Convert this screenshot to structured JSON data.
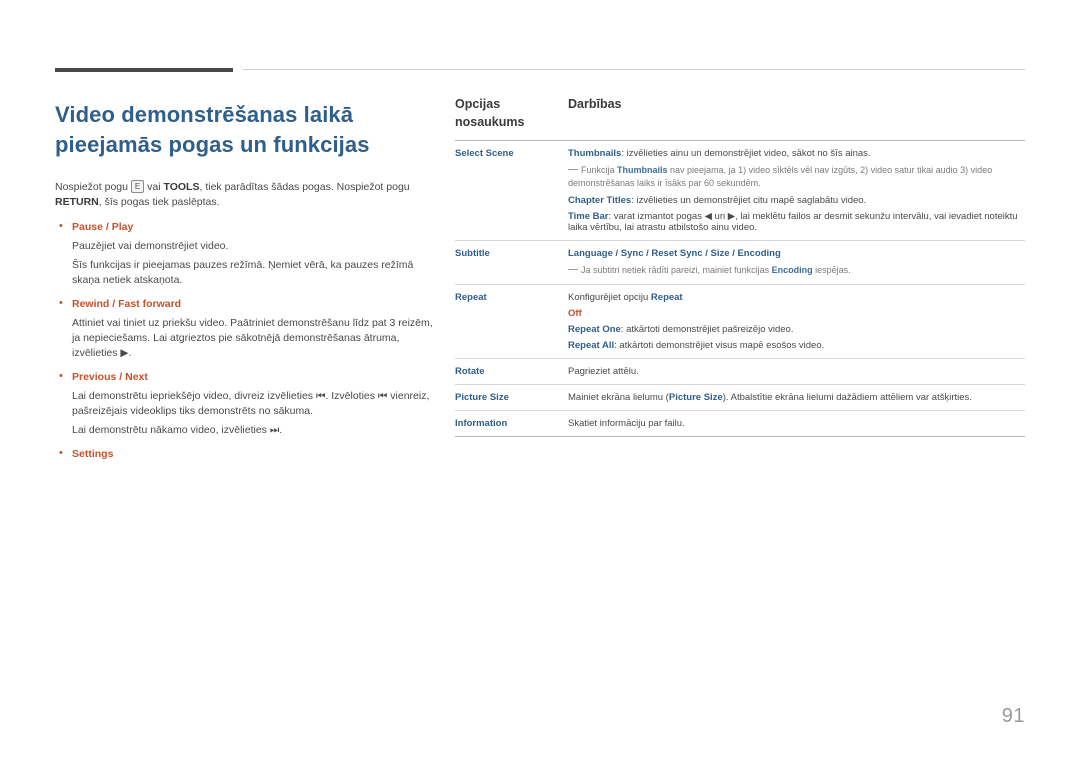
{
  "title": "Video demonstrēšanas laikā pieejamās pogas un funkcijas",
  "page_number": "91",
  "left": {
    "intro_parts": {
      "p1": "Nospiežot pogu ",
      "icon1": "E",
      "p2": " vai ",
      "tools": "TOOLS",
      "p3": ", tiek parādītas šādas pogas. Nospiežot pogu ",
      "return": "RETURN",
      "p4": ", šīs pogas tiek paslēptas."
    },
    "items": [
      {
        "head": "Pause / Play",
        "lines": [
          "Pauzējiet vai demonstrējiet video.",
          "Šīs funkcijas ir pieejamas pauzes režīmā. Ņemiet vērā, ka pauzes režīmā skaņa netiek atskaņota."
        ]
      },
      {
        "head": "Rewind / Fast forward",
        "lines": [
          "Attiniet vai tiniet uz priekšu video. Paātriniet demonstrēšanu līdz pat 3 reizēm, ja nepieciešams. Lai atgrieztos pie sākotnējā demonstrēšanas ātruma, izvēlieties ▶."
        ]
      },
      {
        "head": "Previous / Next",
        "lines": [
          "Lai demonstrētu iepriekšējo video, divreiz izvēlieties ⏮. Izvēloties ⏮ vienreiz, pašreizējais videoklips tiks demonstrēts no sākuma.",
          "Lai demonstrētu nākamo video, izvēlieties ⏭."
        ]
      },
      {
        "head": "Settings",
        "lines": []
      }
    ]
  },
  "table": {
    "header": {
      "col_a": "Opcijas nosaukums",
      "col_b": "Darbības"
    },
    "rows": [
      {
        "name": "Select Scene",
        "lines": [
          {
            "type": "mixed",
            "blue": "Thumbnails",
            "after": ": izvēlieties ainu un demonstrējiet video, sākot no šīs ainas."
          },
          {
            "type": "note",
            "before": "Funkcija ",
            "blue": "Thumbnails",
            "after": " nav pieejama, ja 1) video sīktēls vēl nav izgūts, 2) video satur tikai audio 3) video demonstrēšanas laiks ir īsāks par 60 sekundēm."
          },
          {
            "type": "mixed",
            "blue": "Chapter Titles",
            "after": ": izvēlieties un demonstrējiet citu mapē saglabātu video."
          },
          {
            "type": "mixed",
            "blue": "Time Bar",
            "after": ": varat izmantot pogas ◀ un ▶, lai meklētu failos ar desmit sekunžu intervālu, vai ievadiet noteiktu laika vērtību, lai atrastu atbilstošo ainu video."
          }
        ]
      },
      {
        "name": "Subtitle",
        "lines": [
          {
            "type": "blueline",
            "text": "Language / Sync / Reset Sync / Size / Encoding"
          },
          {
            "type": "note",
            "before": "Ja subtitri netiek rādīti pareizi, mainiet funkcijas ",
            "blue": "Encoding",
            "after": " iespējas."
          }
        ]
      },
      {
        "name": "Repeat",
        "lines": [
          {
            "type": "mixed2",
            "before": "Konfigurējiet opciju ",
            "blue": "Repeat",
            "after": ""
          },
          {
            "type": "orange",
            "text": "Off"
          },
          {
            "type": "mixed",
            "blue": "Repeat One",
            "after": ": atkārtoti demonstrējiet pašreizējo video."
          },
          {
            "type": "mixed",
            "blue": "Repeat All",
            "after": ": atkārtoti demonstrējiet visus mapē esošos video."
          }
        ]
      },
      {
        "name": "Rotate",
        "lines": [
          {
            "type": "plain",
            "text": "Pagrieziet attēlu."
          }
        ]
      },
      {
        "name": "Picture Size",
        "lines": [
          {
            "type": "mixed3",
            "before": "Mainiet ekrāna lielumu (",
            "blue": "Picture Size",
            "after": "). Atbalstītie ekrāna lielumi dažādiem attēliem var atšķirties."
          }
        ]
      },
      {
        "name": "Information",
        "lines": [
          {
            "type": "plain",
            "text": "Skatiet informāciju par failu."
          }
        ]
      }
    ]
  }
}
